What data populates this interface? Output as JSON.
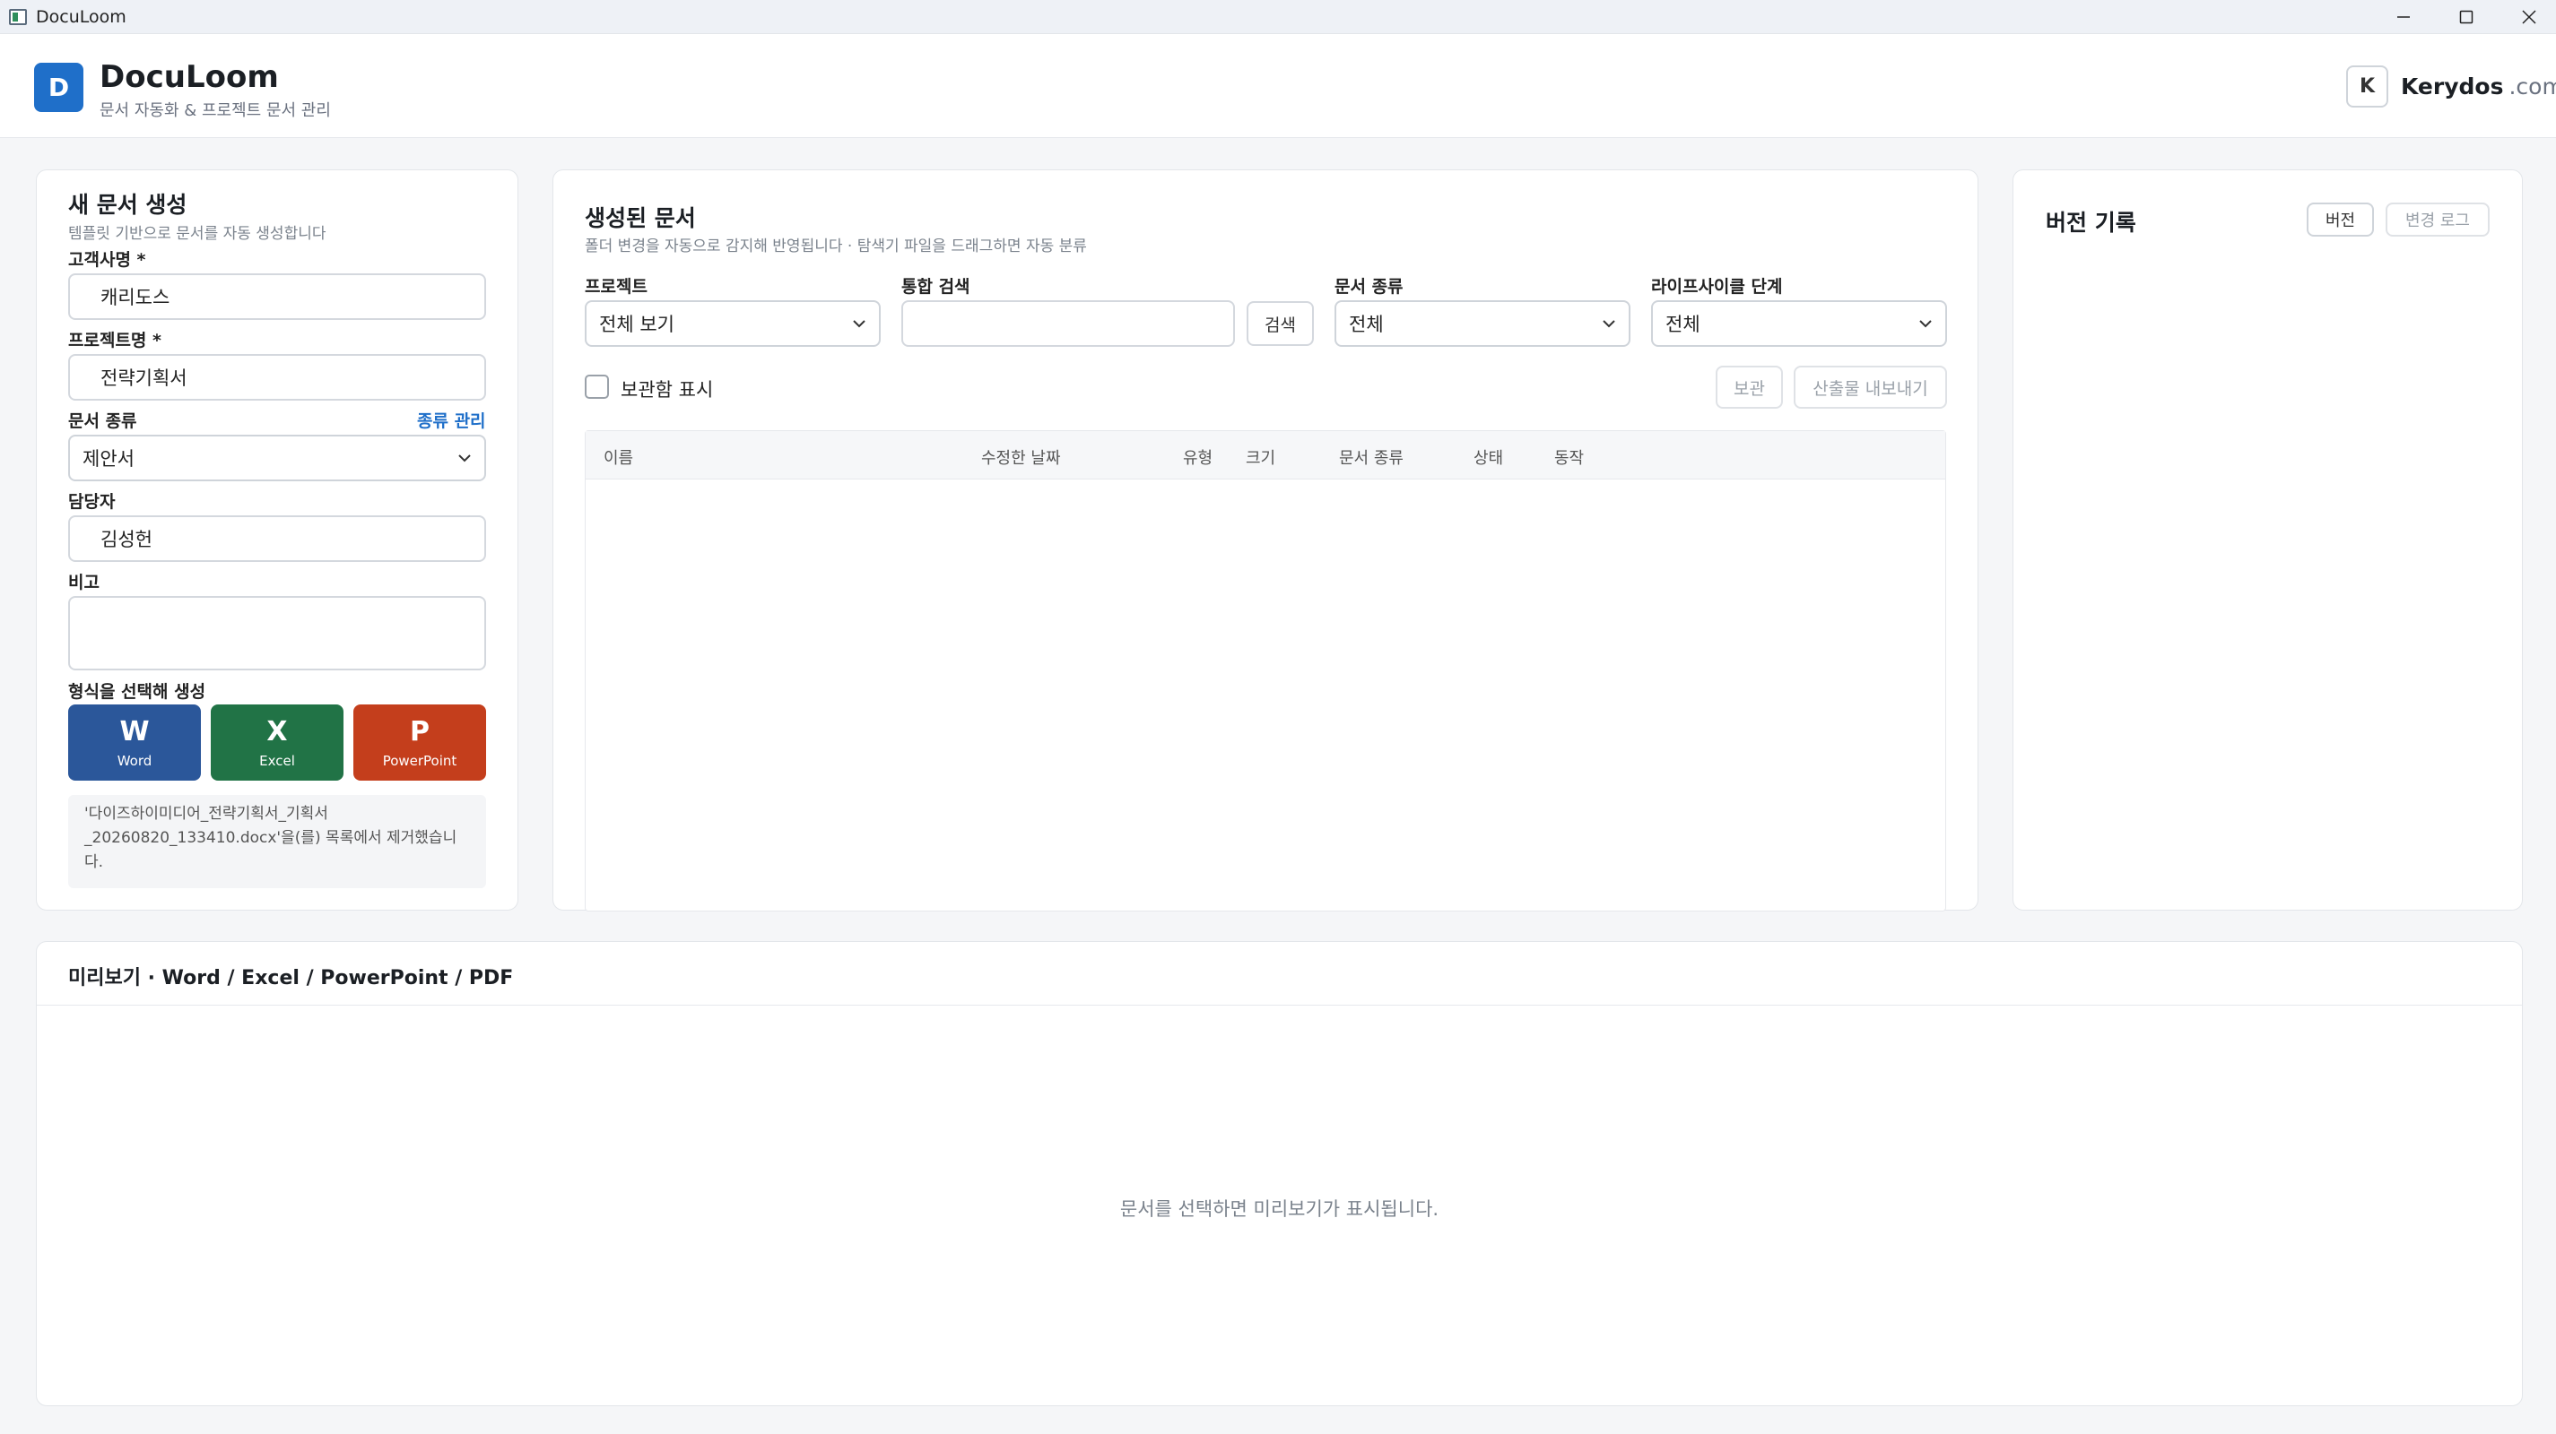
{
  "window": {
    "title": "DocuLoom"
  },
  "header": {
    "logo_letter": "D",
    "brand": "DocuLoom",
    "subtitle": "문서 자동화 & 프로젝트 문서 관리",
    "account_initial": "K",
    "account_name": "Kerydos",
    "account_domain": ".com"
  },
  "create_panel": {
    "title": "새 문서 생성",
    "subtitle": "템플릿 기반으로 문서를 자동 생성합니다",
    "client_label": "고객사명 *",
    "client_value": "캐리도스",
    "project_label": "프로젝트명 *",
    "project_value": "전략기획서",
    "doc_type_label": "문서 종류",
    "doc_type_manage": "종류 관리",
    "doc_type_value": "제안서",
    "owner_label": "담당자",
    "owner_value": "김성헌",
    "note_label": "비고",
    "note_value": "",
    "format_label": "형식을 선택해 생성",
    "formats": [
      {
        "letter": "W",
        "name": "Word",
        "color": "#2b579a"
      },
      {
        "letter": "X",
        "name": "Excel",
        "color": "#217346"
      },
      {
        "letter": "P",
        "name": "PowerPoint",
        "color": "#c43e1c"
      }
    ],
    "notice": "'다이즈하이미디어_전략기획서_기획서_20260820_133410.docx'을(를) 목록에서 제거했습니다."
  },
  "docs_panel": {
    "title": "생성된 문서",
    "subtitle": "폴더 변경을 자동으로 감지해 반영됩니다 · 탐색기 파일을 드래그하면 자동 분류",
    "project_label": "프로젝트",
    "project_value": "전체 보기",
    "search_label": "통합 검색",
    "search_value": "",
    "search_button": "검색",
    "doc_type_label": "문서 종류",
    "doc_type_value": "전체",
    "lifecycle_label": "라이프사이클 단계",
    "lifecycle_value": "전체",
    "archive_checkbox": "보관함 표시",
    "archive_button": "보관",
    "export_button": "산출물 내보내기",
    "columns": [
      "이름",
      "수정한 날짜",
      "유형",
      "크기",
      "문서 종류",
      "상태",
      "동작"
    ]
  },
  "version_panel": {
    "title": "버전 기록",
    "tab_version": "버전",
    "tab_changelog": "변경 로그"
  },
  "preview_panel": {
    "title": "미리보기 · Word / Excel / PowerPoint / PDF",
    "empty": "문서를 선택하면 미리보기가 표시됩니다."
  }
}
